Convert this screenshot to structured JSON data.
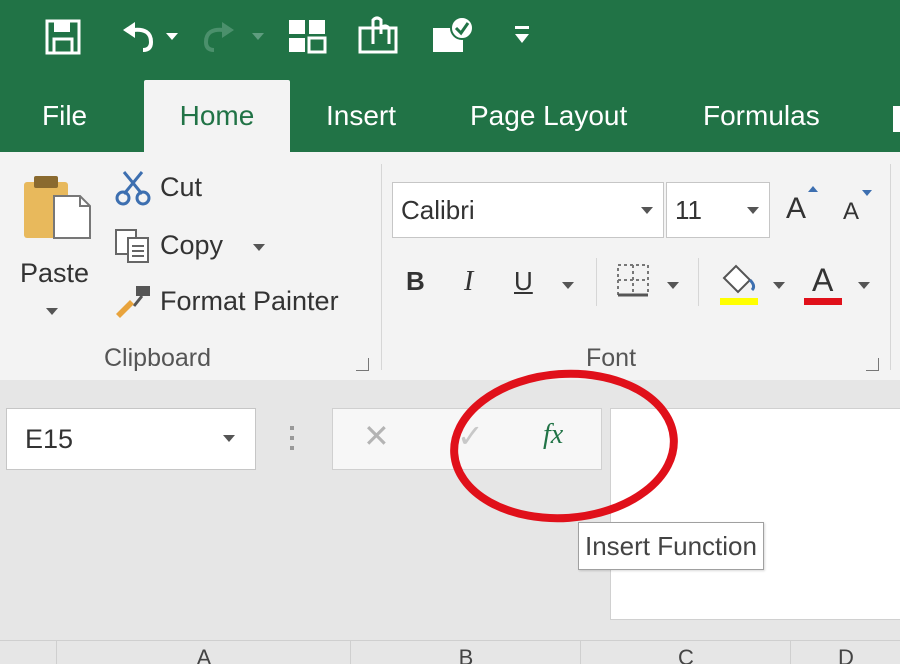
{
  "colors": {
    "excel_green": "#217346",
    "annotation_red": "#e0101a",
    "fx_green": "#217346"
  },
  "quick_access": {
    "icons": [
      "save-icon",
      "undo-icon",
      "redo-icon",
      "layout-icon",
      "touch-mode-icon",
      "approve-icon",
      "customize-icon"
    ]
  },
  "tabs": [
    {
      "label": "File"
    },
    {
      "label": "Home"
    },
    {
      "label": "Insert"
    },
    {
      "label": "Page Layout"
    },
    {
      "label": "Formulas"
    }
  ],
  "clipboard": {
    "paste_label": "Paste",
    "cut_label": "Cut",
    "copy_label": "Copy",
    "format_painter_label": "Format Painter",
    "group_label": "Clipboard"
  },
  "font": {
    "font_name": "Calibri",
    "font_size": "11",
    "bold": "B",
    "italic": "I",
    "underline": "U",
    "increase_size": "A",
    "decrease_size": "A",
    "font_color_glyph": "A",
    "group_label": "Font"
  },
  "formula_bar": {
    "name_box_value": "E15",
    "cancel_glyph": "✕",
    "enter_glyph": "✓",
    "fx_label": "fx",
    "tooltip": "Insert Function"
  },
  "columns": [
    "A",
    "B",
    "C",
    "D"
  ]
}
